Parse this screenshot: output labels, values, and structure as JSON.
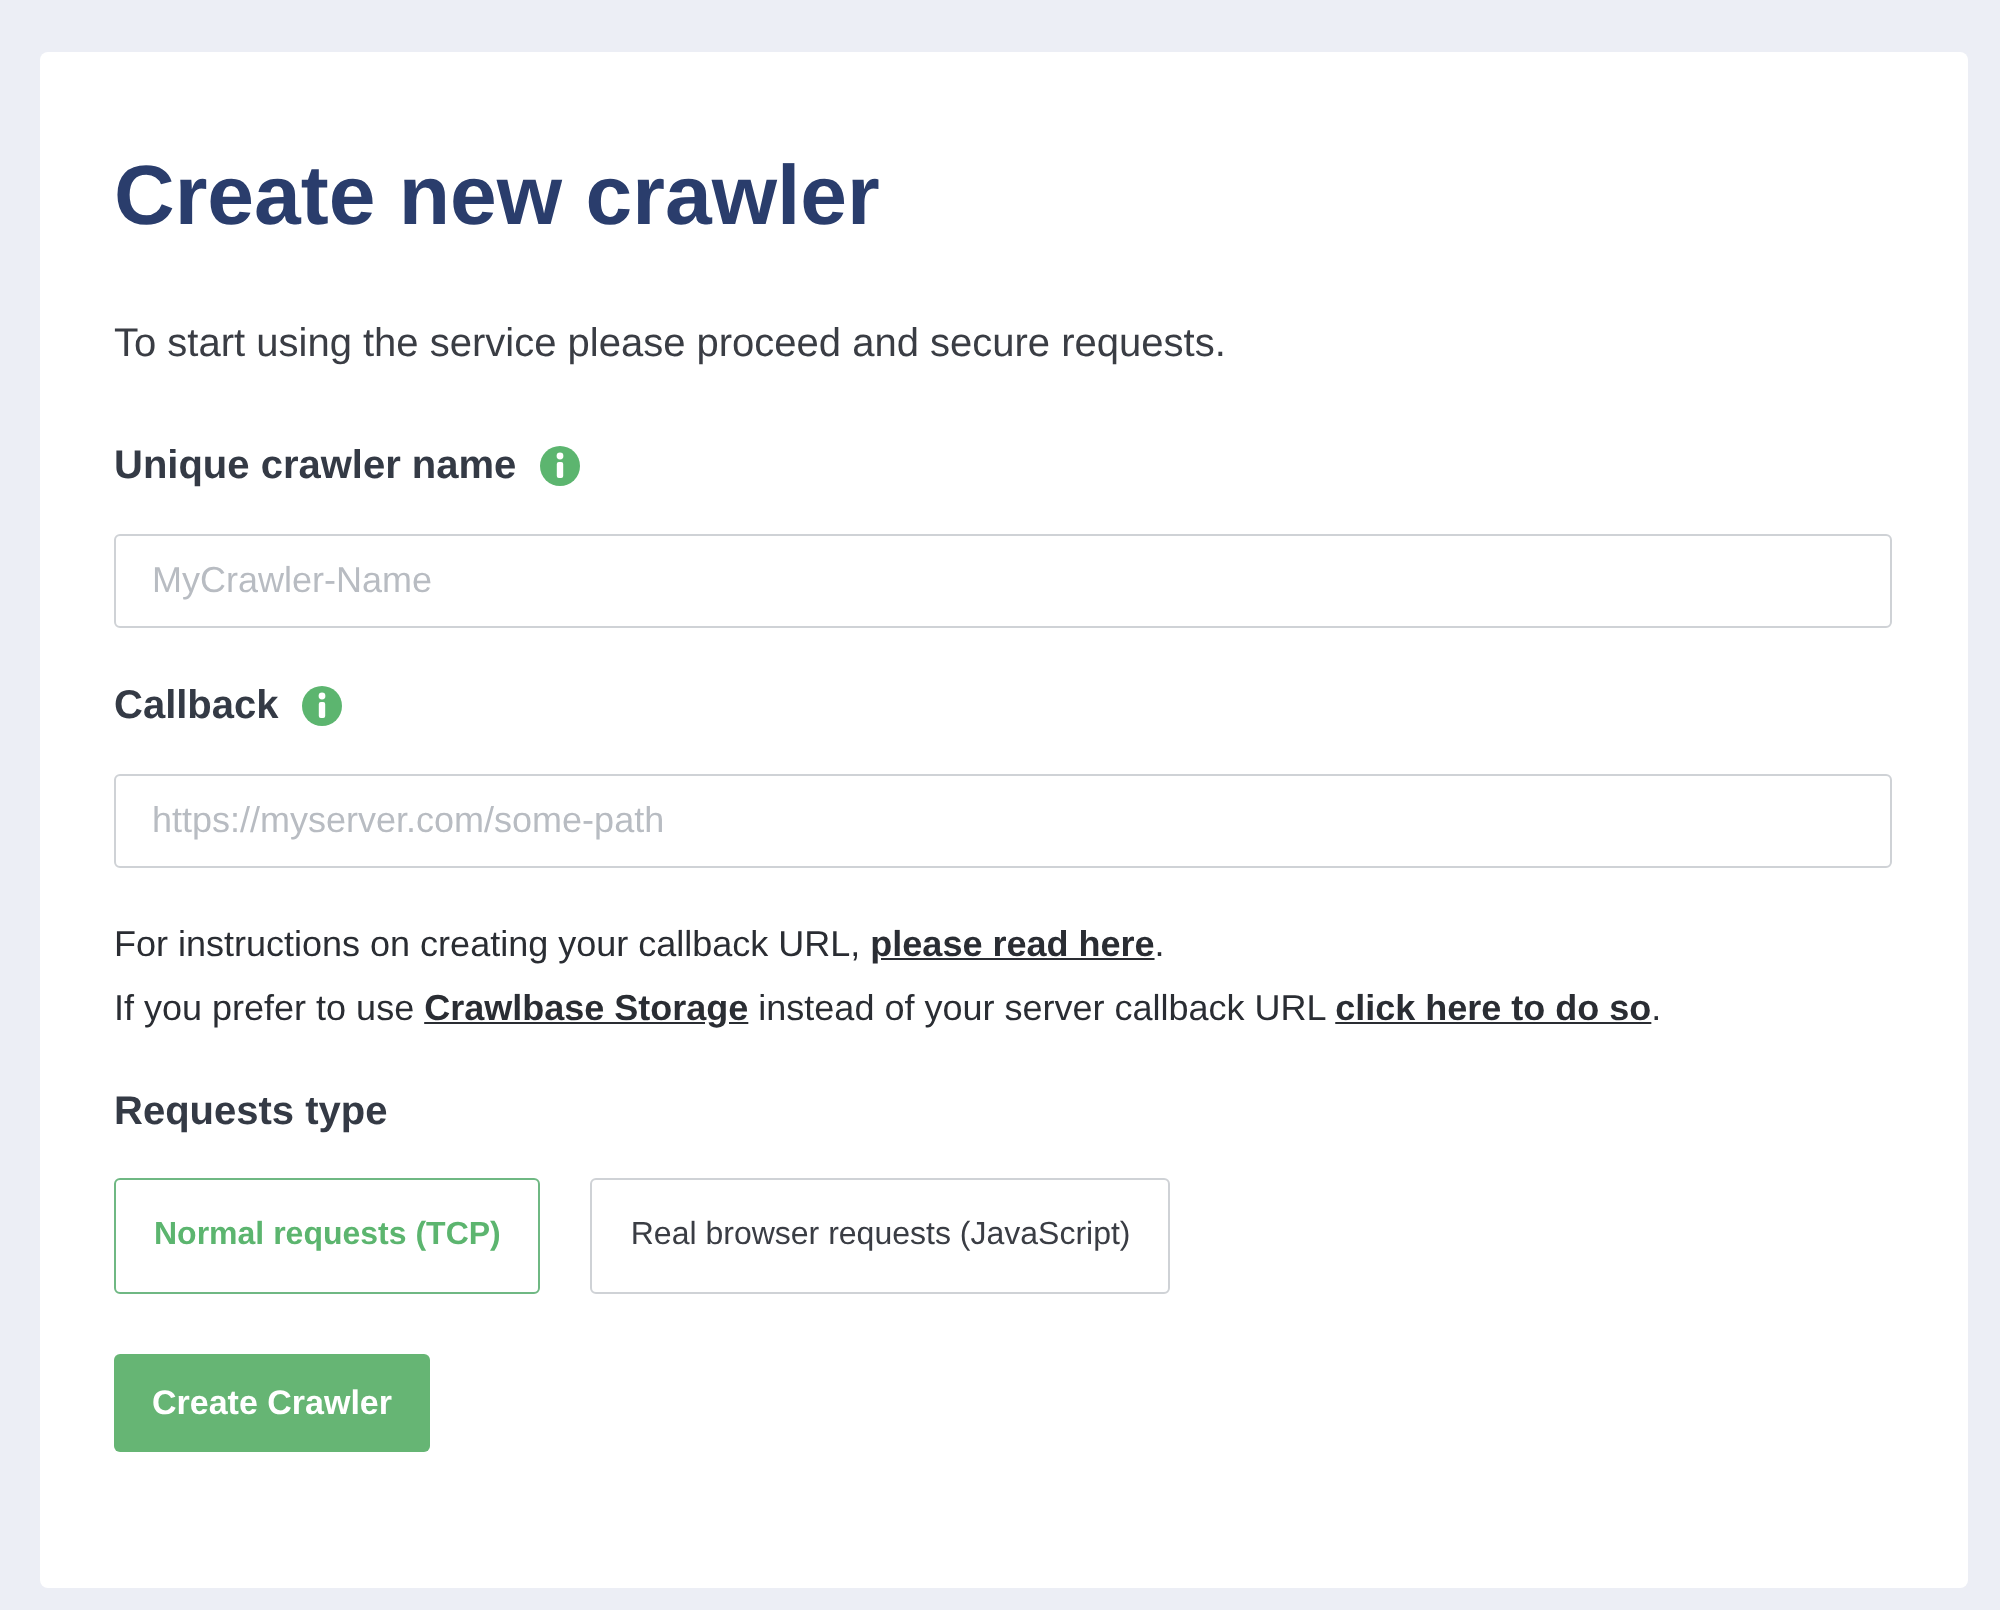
{
  "title": "Create new crawler",
  "subtitle": "To start using the service please proceed and secure requests.",
  "fields": [
    {
      "label": "Unique crawler name",
      "placeholder": "MyCrawler-Name"
    },
    {
      "label": "Callback",
      "placeholder": "https://myserver.com/some-path"
    }
  ],
  "help_lines": [
    [
      {
        "kind": "text",
        "text": "For instructions on creating your callback URL, "
      },
      {
        "kind": "link",
        "text": "please read here"
      },
      {
        "kind": "text",
        "text": "."
      }
    ],
    [
      {
        "kind": "text",
        "text": "If you prefer to use "
      },
      {
        "kind": "link",
        "text": "Crawlbase Storage"
      },
      {
        "kind": "text",
        "text": " instead of your server callback URL "
      },
      {
        "kind": "link",
        "text": "click here to do so"
      },
      {
        "kind": "text",
        "text": "."
      }
    ]
  ],
  "requests_type": {
    "label": "Requests type",
    "options": [
      {
        "label": "Normal requests (TCP)",
        "selected": true
      },
      {
        "label": "Real browser requests (JavaScript)",
        "selected": false
      }
    ]
  },
  "submit": "Create Crawler"
}
